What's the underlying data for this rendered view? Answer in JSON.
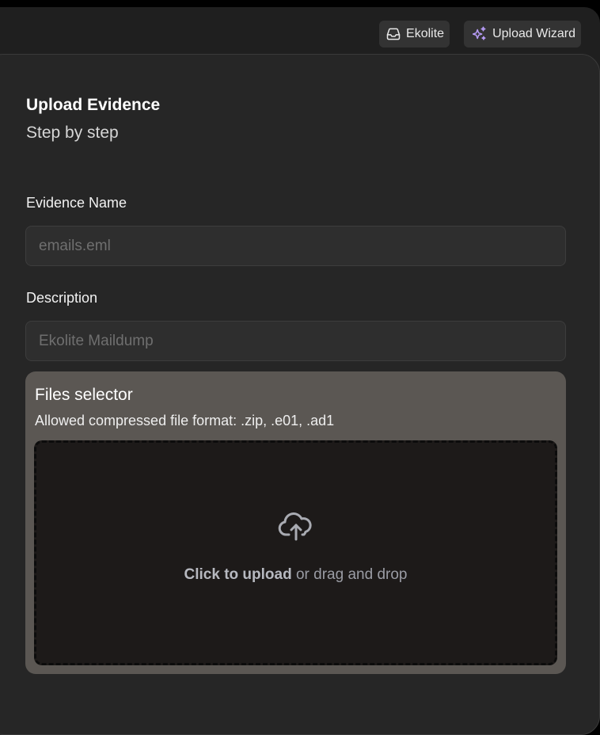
{
  "topbar": {
    "workspace_label": "Ekolite",
    "wizard_label": "Upload Wizard",
    "wizard_icon": "sparkles-icon",
    "workspace_icon": "inbox-icon",
    "wizard_icon_color": "#b79cf7"
  },
  "form": {
    "title": "Upload Evidence",
    "subtitle": "Step by step",
    "name_label": "Evidence Name",
    "name_placeholder": "emails.eml",
    "description_label": "Description",
    "description_placeholder": "Ekolite Maildump"
  },
  "files_selector": {
    "title": "Files selector",
    "subtitle": "Allowed compressed file format: .zip, .e01, .ad1",
    "click_text": "Click to upload",
    "drag_text": " or drag and drop",
    "icon": "cloud-upload-icon"
  }
}
